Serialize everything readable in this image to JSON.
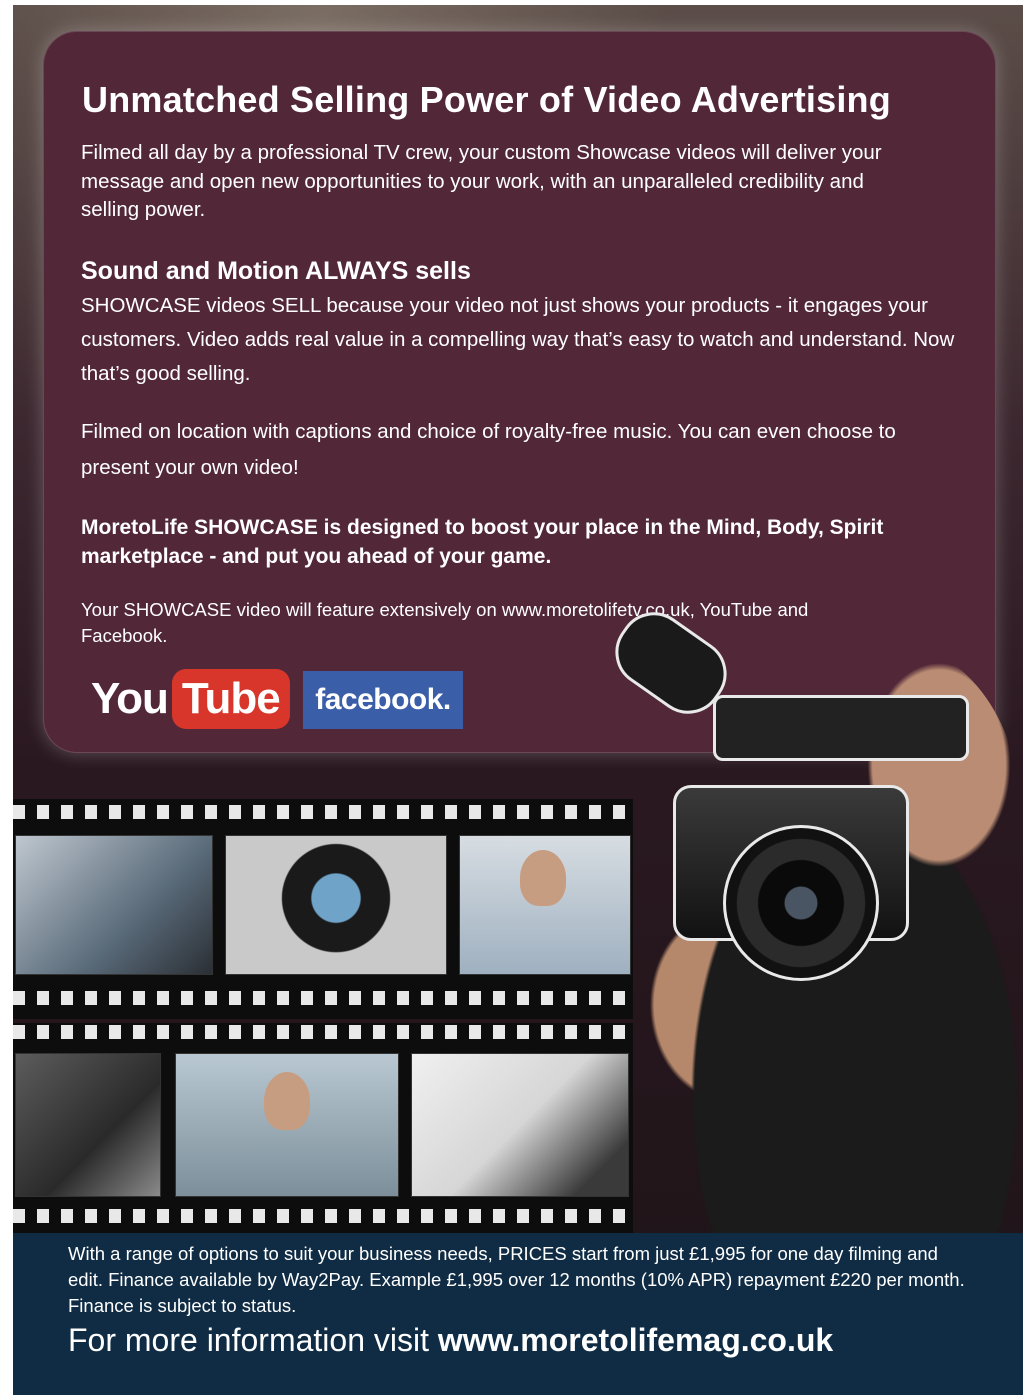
{
  "panel": {
    "heading": "Unmatched Selling Power of Video Advertising",
    "intro": "Filmed all day by a professional TV crew, your custom Showcase videos will deliver your message and open new opportunities to your work, with an unparalleled credibility and selling power.",
    "subheading": "Sound and Motion ALWAYS sells",
    "body1": "SHOWCASE videos SELL because your video not just shows your products - it engages your customers. Video adds real value in a compelling way that’s easy to watch and understand. Now that’s good selling.",
    "body2": "Filmed on location with captions and choice of royalty-free music. You can even choose to present your own video!",
    "body3": "MoretoLife SHOWCASE is designed to boost your place in the Mind, Body, Spirit marketplace - and put you ahead of your game.",
    "body4": "Your SHOWCASE video will feature extensively on www.moretolifetv.co.uk, YouTube and Facebook."
  },
  "logos": {
    "youtube_you": "You",
    "youtube_tube": "Tube",
    "facebook": "facebook."
  },
  "footer": {
    "text": "With a range of options to suit your business needs, PRICES start from just £1,995 for one day filming and edit. Finance available by Way2Pay. Example £1,995 over 12 months (10% APR) repayment £220 per month. Finance is subject to status.",
    "cta_prefix": "For more information visit ",
    "cta_url": "www.moretolifemag.co.uk"
  },
  "colors": {
    "panel": "#522838",
    "footer": "#0f2c44",
    "youtube_red": "#d9362b",
    "facebook_blue": "#3b5ea8"
  }
}
